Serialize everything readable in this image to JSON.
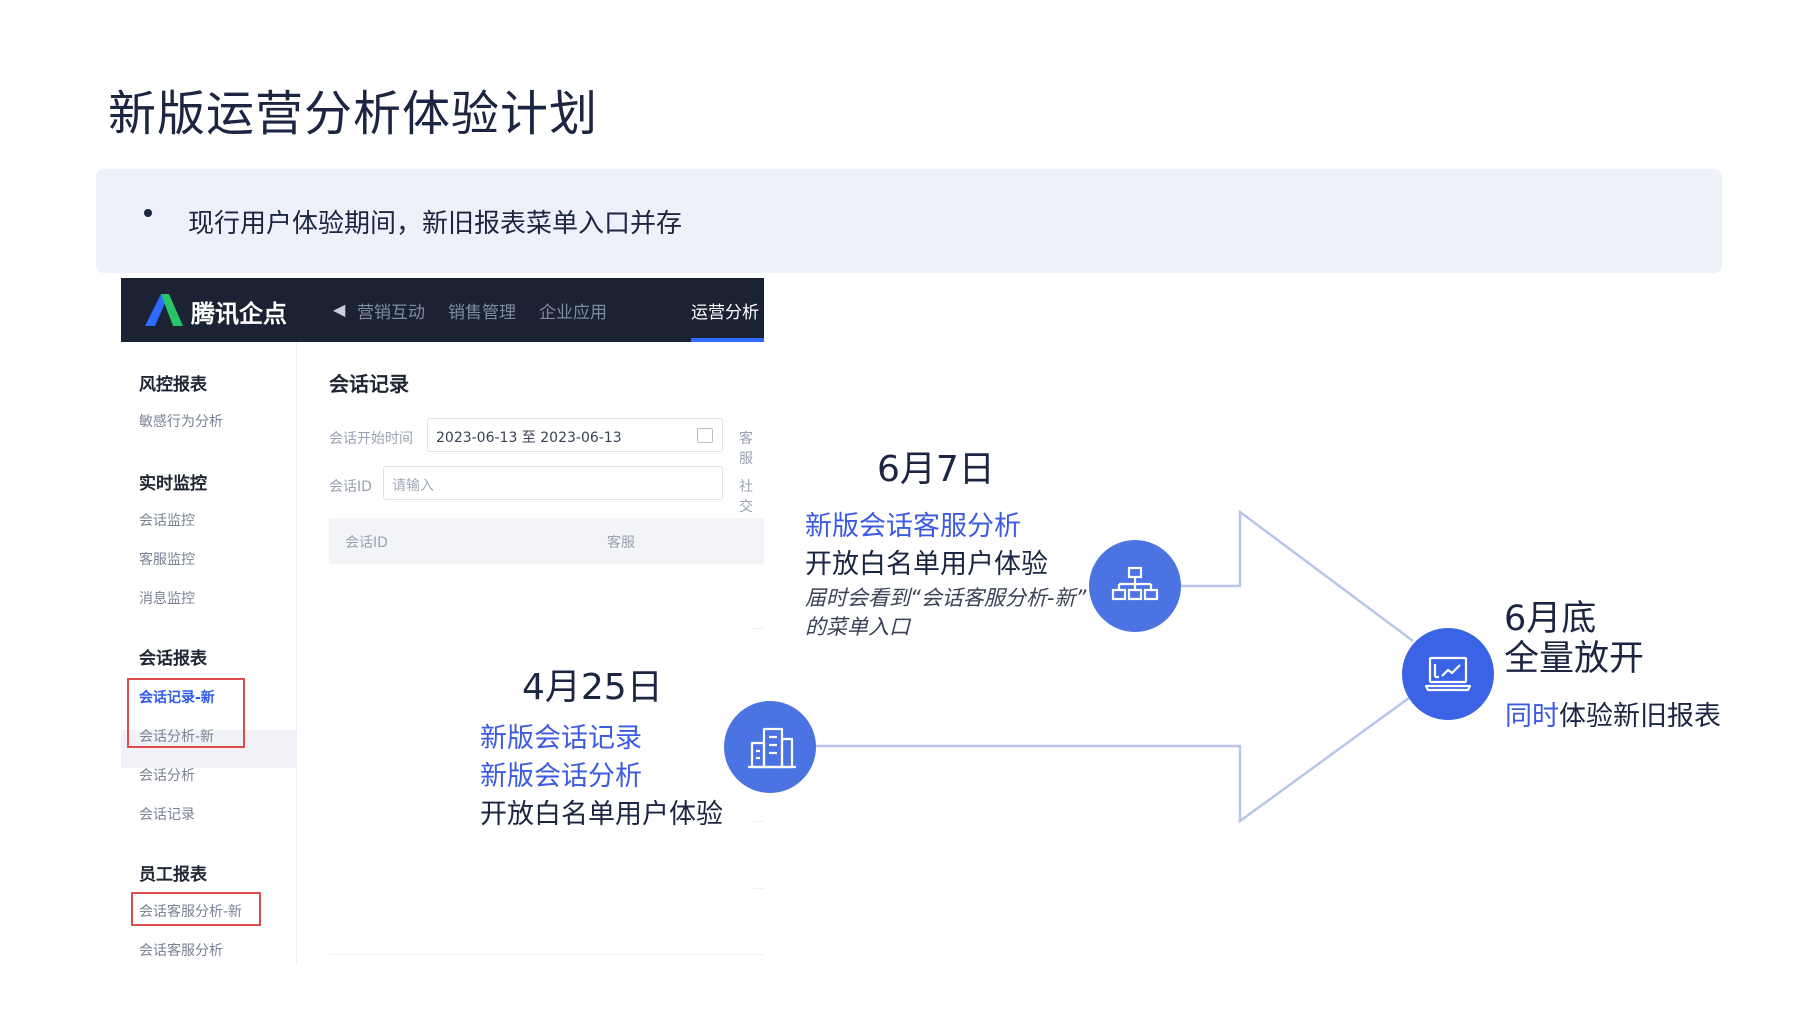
{
  "title": "新版运营分析体验计划",
  "banner": {
    "bullet": "现行用户体验期间，新旧报表菜单入口并存"
  },
  "app": {
    "brand": "腾讯企点",
    "nav": [
      "营销互动",
      "销售管理",
      "企业应用",
      "运营分析"
    ],
    "sidebar": {
      "groups": [
        {
          "heading": "风控报表",
          "items": [
            "敏感行为分析"
          ]
        },
        {
          "heading": "实时监控",
          "items": [
            "会话监控",
            "客服监控",
            "消息监控"
          ]
        },
        {
          "heading": "会话报表",
          "items": [
            "会话记录-新",
            "会话分析-新",
            "会话分析",
            "会话记录"
          ]
        },
        {
          "heading": "员工报表",
          "items": [
            "会话客服分析-新",
            "会话客服分析"
          ]
        }
      ]
    },
    "content": {
      "title": "会话记录",
      "start_time_label": "会话开始时间",
      "start_time_value": "2023-06-13 至 2023-06-13",
      "extra_label_1": "客服",
      "session_id_label": "会话ID",
      "session_id_placeholder": "请输入",
      "extra_label_2": "社交",
      "table_headers": [
        "会话ID",
        "客服"
      ]
    }
  },
  "timeline": {
    "stage1": {
      "date": "4月25日",
      "lines": [
        "新版会话记录",
        "新版会话分析"
      ],
      "desc": "开放白名单用户体验",
      "icon": "building-icon"
    },
    "stage2": {
      "date": "6月7日",
      "line": "新版会话客服分析",
      "desc": "开放白名单用户体验",
      "note1": "届时会看到“会话客服分析-新”",
      "note2": "的菜单入口",
      "icon": "org-chart-icon"
    },
    "stage3": {
      "date": "6月底",
      "headline": "全量放开",
      "highlight": "同时",
      "rest": "体验新旧报表",
      "icon": "laptop-chart-icon"
    }
  },
  "colors": {
    "accent": "#3d5be0",
    "circle": "#4b73e2",
    "navbar": "#1b2233",
    "highlight_box": "#e14b4b",
    "banner_bg": "#eef0fa"
  }
}
